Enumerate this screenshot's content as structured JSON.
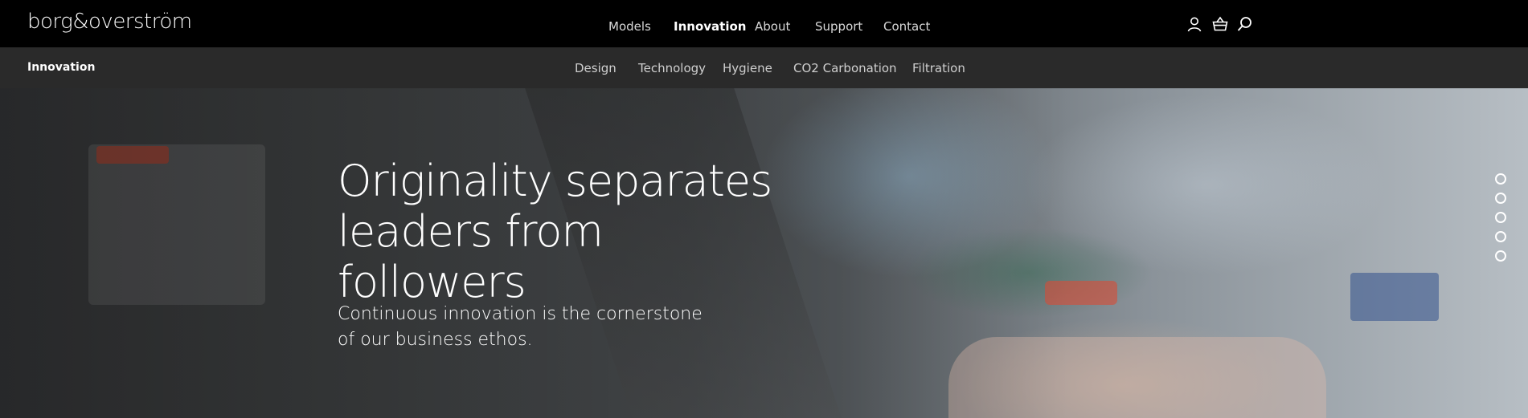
{
  "brand": {
    "logo": "borg&overström"
  },
  "main_nav": [
    {
      "label": "Models",
      "active": false
    },
    {
      "label": "Innovation",
      "active": true
    },
    {
      "label": "About",
      "active": false
    },
    {
      "label": "Support",
      "active": false
    },
    {
      "label": "Contact",
      "active": false
    }
  ],
  "header_icons": [
    "account-icon",
    "basket-icon",
    "search-icon"
  ],
  "sub_nav": {
    "section_title": "Innovation",
    "items": [
      {
        "label": "Design"
      },
      {
        "label": "Technology"
      },
      {
        "label": "Hygiene"
      },
      {
        "label": "CO2 Carbonation"
      },
      {
        "label": "Filtration"
      }
    ]
  },
  "hero": {
    "headline_line1": "Originality separates",
    "headline_line2": "leaders from followers",
    "subheadline": "Continuous innovation is the cornerstone of our business ethos.",
    "pagination_count": 5,
    "active_slide": 1
  },
  "colors": {
    "topbar_bg": "#000000",
    "subbar_bg": "#2a2a2a",
    "text": "#ffffff"
  }
}
